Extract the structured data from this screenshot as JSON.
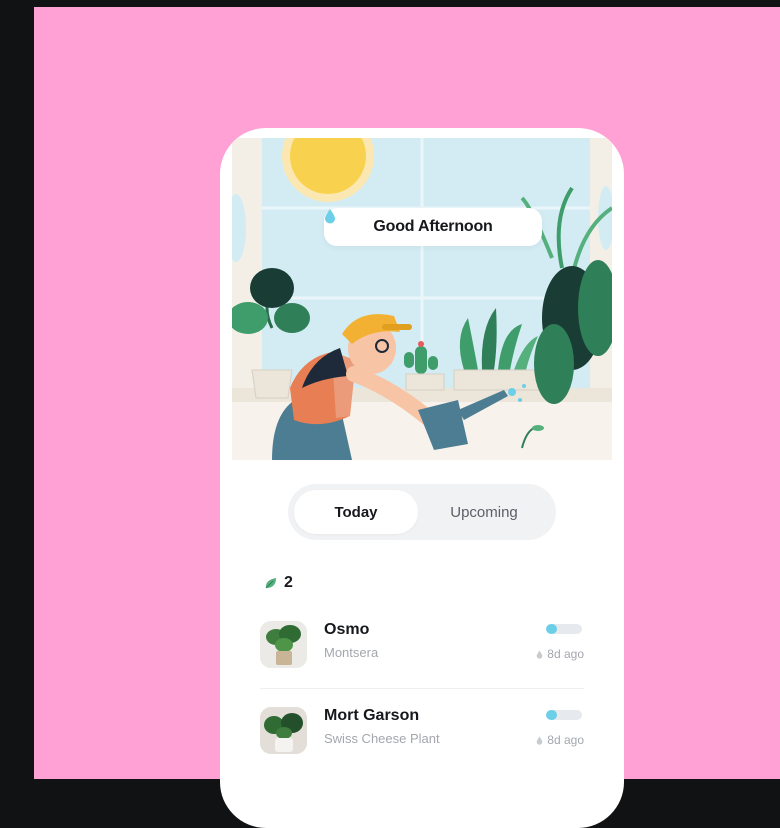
{
  "greeting": {
    "text": "Good Afternoon",
    "icon": "water-drop-icon"
  },
  "tabs": {
    "active": "Today",
    "inactive": "Upcoming"
  },
  "plant_count": {
    "icon": "leaf-icon",
    "value": "2"
  },
  "plants": [
    {
      "name": "Osmo",
      "species": "Montsera",
      "last_watered": "8d ago",
      "water_level": 0.3
    },
    {
      "name": "Mort Garson",
      "species": "Swiss Cheese Plant",
      "last_watered": "8d ago",
      "water_level": 0.3
    }
  ],
  "colors": {
    "background": "#ffa1d5",
    "accent_water": "#6ccfe8",
    "text_primary": "#16181c",
    "text_secondary": "#a3a7ad"
  }
}
